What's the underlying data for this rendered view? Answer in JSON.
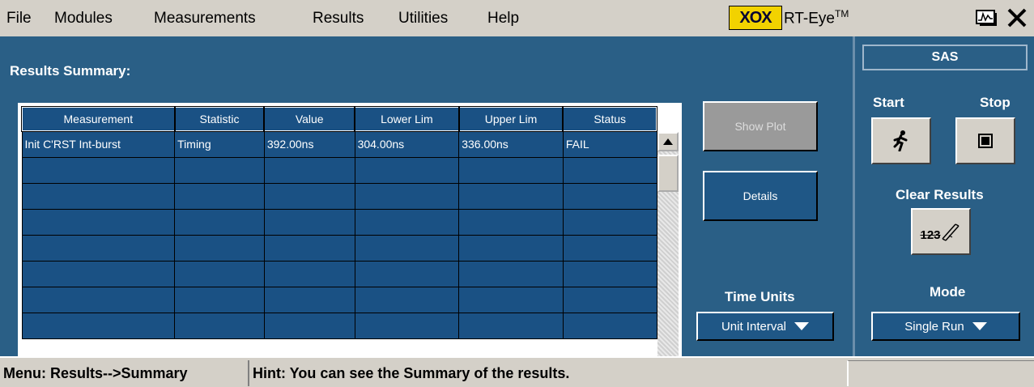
{
  "menu": [
    "File",
    "Modules",
    "Measurements",
    "Results",
    "Utilities",
    "Help"
  ],
  "brand": {
    "logo_text": "XOX",
    "name": "RT-Eye",
    "tm": "TM"
  },
  "summary_title": "Results Summary:",
  "table": {
    "columns": [
      "Measurement",
      "Statistic",
      "Value",
      "Lower Lim",
      "Upper Lim",
      "Status"
    ],
    "rows": [
      [
        "Init C'RST Int-burst",
        "Timing",
        "392.00ns",
        "304.00ns",
        "336.00ns",
        "FAIL"
      ],
      [
        "",
        "",
        "",
        "",
        "",
        ""
      ],
      [
        "",
        "",
        "",
        "",
        "",
        ""
      ],
      [
        "",
        "",
        "",
        "",
        "",
        ""
      ],
      [
        "",
        "",
        "",
        "",
        "",
        ""
      ],
      [
        "",
        "",
        "",
        "",
        "",
        ""
      ],
      [
        "",
        "",
        "",
        "",
        "",
        ""
      ],
      [
        "",
        "",
        "",
        "",
        "",
        ""
      ]
    ]
  },
  "buttons": {
    "show_plot": "Show Plot",
    "details": "Details"
  },
  "time_units": {
    "label": "Time Units",
    "value": "Unit Interval"
  },
  "right_panel": {
    "standard": "SAS",
    "start_label": "Start",
    "stop_label": "Stop",
    "clear_label": "Clear Results",
    "clear_icon_text": "123",
    "mode_label": "Mode",
    "mode_value": "Single Run"
  },
  "status": {
    "menu": "Menu: Results-->Summary",
    "hint": "Hint: You can see the Summary of the results."
  }
}
